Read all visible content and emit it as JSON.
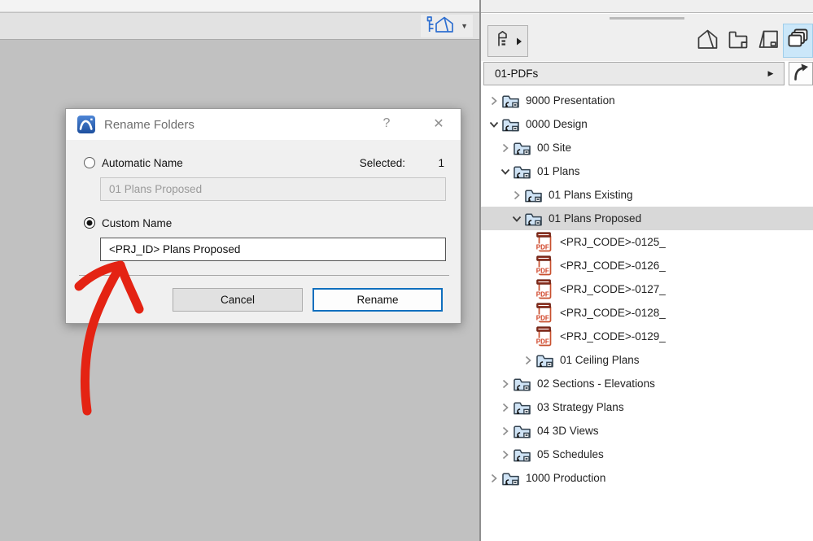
{
  "left_panel": {
    "navigator_flyout": {
      "icon": "navigator-house-icon",
      "dropdown_glyph": "▼"
    }
  },
  "dialog": {
    "logo_icon": "archicad-logo-icon",
    "title": "Rename Folders",
    "help_button": "?",
    "close_button": "✕",
    "selected_label": "Selected:",
    "selected_count": "1",
    "automatic_option": {
      "label": "Automatic Name",
      "checked": false,
      "value": "01 Plans Proposed"
    },
    "custom_option": {
      "label": "Custom Name",
      "checked": true,
      "value": "<PRJ_ID> Plans Proposed"
    },
    "cancel_button": "Cancel",
    "rename_button": "Rename"
  },
  "right_panel": {
    "tree_scheme_button": {
      "icon": "project-tree-icon",
      "flyout_glyph": "▶"
    },
    "map_tabs": [
      {
        "name": "project-map-icon",
        "active": false
      },
      {
        "name": "view-map-icon",
        "active": false
      },
      {
        "name": "layout-book-icon",
        "active": false
      },
      {
        "name": "publisher-sets-icon",
        "active": true
      }
    ],
    "path_bar": {
      "value": "01-PDFs",
      "expand_glyph": "▶"
    },
    "up_button_icon": "up-one-level-icon",
    "tree": {
      "items": [
        {
          "label": "9000 Presentation",
          "level": 0,
          "state": "collapsed",
          "icon": "publisher-folder-icon",
          "selected": false
        },
        {
          "label": "0000 Design",
          "level": 0,
          "state": "expanded",
          "icon": "publisher-folder-icon",
          "selected": false
        },
        {
          "label": "00 Site",
          "level": 1,
          "state": "collapsed",
          "icon": "publisher-folder-icon",
          "selected": false
        },
        {
          "label": "01 Plans",
          "level": 1,
          "state": "expanded",
          "icon": "publisher-folder-icon",
          "selected": false
        },
        {
          "label": "01 Plans Existing",
          "level": 2,
          "state": "collapsed",
          "icon": "publisher-folder-icon",
          "selected": false
        },
        {
          "label": "01 Plans Proposed",
          "level": 2,
          "state": "expanded",
          "icon": "publisher-folder-icon",
          "selected": true
        },
        {
          "label": "<PRJ_CODE>-0125_",
          "level": 3,
          "state": "leaf",
          "icon": "pdf-file-icon",
          "selected": false
        },
        {
          "label": "<PRJ_CODE>-0126_",
          "level": 3,
          "state": "leaf",
          "icon": "pdf-file-icon",
          "selected": false
        },
        {
          "label": "<PRJ_CODE>-0127_",
          "level": 3,
          "state": "leaf",
          "icon": "pdf-file-icon",
          "selected": false
        },
        {
          "label": "<PRJ_CODE>-0128_",
          "level": 3,
          "state": "leaf",
          "icon": "pdf-file-icon",
          "selected": false
        },
        {
          "label": "<PRJ_CODE>-0129_",
          "level": 3,
          "state": "leaf",
          "icon": "pdf-file-icon",
          "selected": false
        },
        {
          "label": "01 Ceiling Plans",
          "level": 3,
          "state": "collapsed",
          "icon": "publisher-folder-icon",
          "selected": false
        },
        {
          "label": "02 Sections - Elevations",
          "level": 1,
          "state": "collapsed",
          "icon": "publisher-folder-icon",
          "selected": false
        },
        {
          "label": "03 Strategy Plans",
          "level": 1,
          "state": "collapsed",
          "icon": "publisher-folder-icon",
          "selected": false
        },
        {
          "label": "04 3D Views",
          "level": 1,
          "state": "collapsed",
          "icon": "publisher-folder-icon",
          "selected": false
        },
        {
          "label": "05 Schedules",
          "level": 1,
          "state": "collapsed",
          "icon": "publisher-folder-icon",
          "selected": false
        },
        {
          "label": "1000 Production",
          "level": 0,
          "state": "collapsed",
          "icon": "publisher-folder-icon",
          "selected": false
        }
      ]
    }
  },
  "colors": {
    "accent_blue": "#0f6fbe",
    "selection_gray": "#d8d8d8",
    "icon_highlight": "#cbe7f9",
    "arrow_red": "#e42313",
    "folder_fill": "#cfe3f5",
    "pdf_red": "#cf3f22"
  }
}
